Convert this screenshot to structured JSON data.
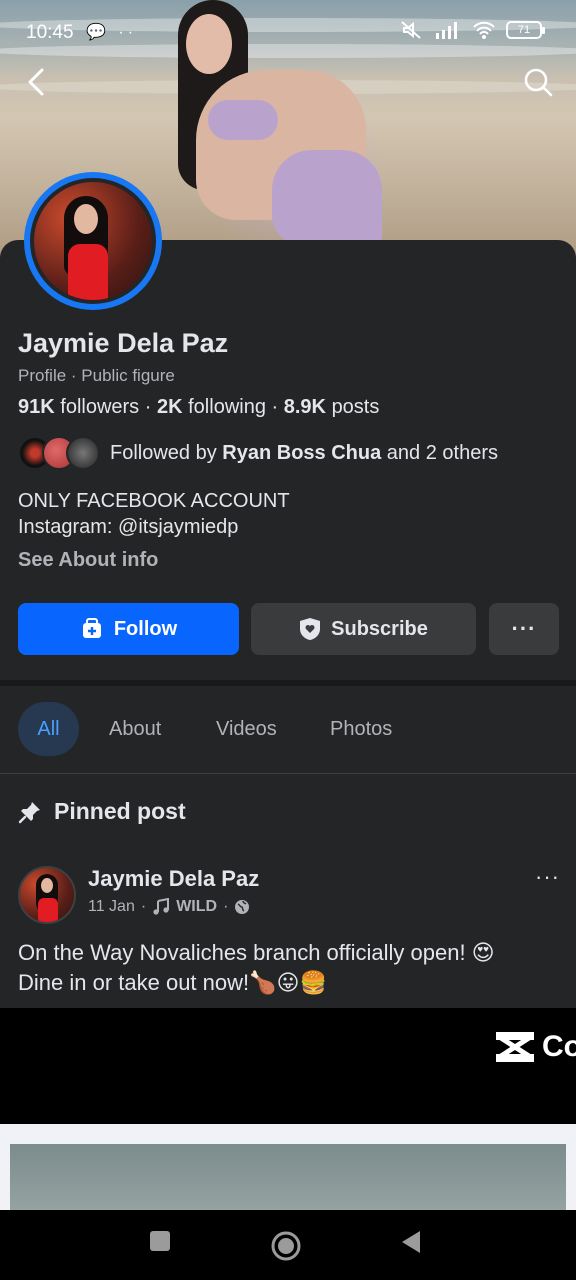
{
  "status_bar": {
    "time": "10:45",
    "left_icons": "💬 ··",
    "battery": "71",
    "right_icons": [
      "mute-icon",
      "signal-icon",
      "wifi-icon",
      "battery-icon"
    ]
  },
  "nav": {
    "back_icon": "chevron-left-icon",
    "search_icon": "search-icon"
  },
  "profile": {
    "name": "Jaymie Dela Paz",
    "subtitle": "Profile · Public figure",
    "followers_count": "91K",
    "followers_label": "followers",
    "following_count": "2K",
    "following_label": "following",
    "posts_count": "8.9K",
    "posts_label": "posts",
    "sep": "·",
    "followed_by_prefix": "Followed by",
    "followed_by_name": "Ryan Boss Chua",
    "followed_by_suffix": "and 2 others",
    "bio_line1": "ONLY FACEBOOK ACCOUNT",
    "bio_line2": "Instagram: @itsjaymiedp",
    "see_about": "See About info"
  },
  "actions": {
    "follow": "Follow",
    "subscribe": "Subscribe",
    "more": "···"
  },
  "tabs": [
    {
      "label": "All",
      "active": true
    },
    {
      "label": "About",
      "active": false
    },
    {
      "label": "Videos",
      "active": false
    },
    {
      "label": "Photos",
      "active": false
    }
  ],
  "pinned": {
    "label": "Pinned post"
  },
  "post": {
    "author": "Jaymie Dela Paz",
    "date": "11 Jan",
    "dot": "·",
    "music": "WILD",
    "more": "···",
    "text_line1": "On the Way Novaliches branch officially open! 😍",
    "text_line2": "Dine in or take out now!🍗😛🍔"
  },
  "media": {
    "brand_text": "Co"
  },
  "colors": {
    "background": "#242526",
    "accent_blue": "#0866ff",
    "active_tab_bg": "#263951",
    "active_tab_text": "#4a9fff",
    "secondary_button": "#3a3b3c"
  }
}
